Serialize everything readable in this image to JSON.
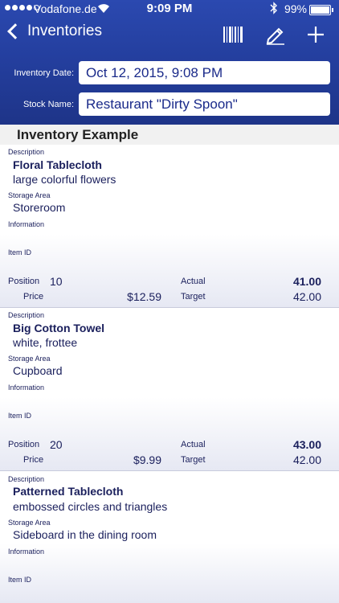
{
  "status": {
    "carrier": "Vodafone.de",
    "time": "9:09 PM",
    "battery": "99%",
    "battery_level": 0.99
  },
  "nav": {
    "back_label": "Inventories"
  },
  "form": {
    "date_label": "Inventory Date:",
    "date_value": "Oct 12, 2015, 9:08 PM",
    "stock_label": "Stock Name:",
    "stock_value": "Restaurant \"Dirty Spoon\""
  },
  "section_title": "Inventory Example",
  "labels": {
    "description": "Description",
    "storage": "Storage Area",
    "information": "Information",
    "item_id": "Item ID",
    "position": "Position",
    "price": "Price",
    "actual": "Actual",
    "target": "Target"
  },
  "items": [
    {
      "name": "Floral Tablecloth",
      "detail": "large colorful flowers",
      "storage": "Storeroom",
      "position": "10",
      "price": "$12.59",
      "actual": "41.00",
      "target": "42.00"
    },
    {
      "name": "Big Cotton Towel",
      "detail": "white, frottee",
      "storage": "Cupboard",
      "position": "20",
      "price": "$9.99",
      "actual": "43.00",
      "target": "42.00"
    },
    {
      "name": "Patterned Tablecloth",
      "detail": "embossed circles and triangles",
      "storage": "Sideboard in the dining room"
    }
  ]
}
